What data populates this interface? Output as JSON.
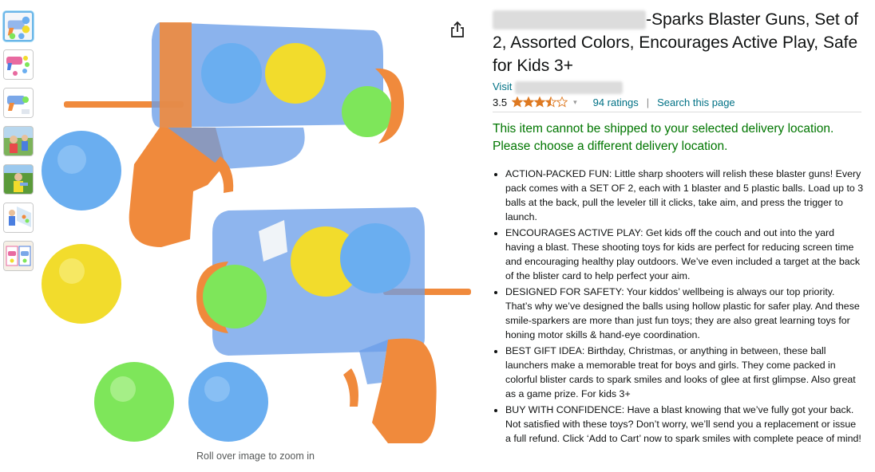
{
  "title": {
    "blurred_prefix": "redacted brand name",
    "text": "-Sparks Blaster Guns, Set of 2, Assorted Colors, Encourages Active Play, Safe for Kids 3+"
  },
  "visit": {
    "prefix": "Visit",
    "blurred": "redacted store"
  },
  "rating": {
    "value": "3.5",
    "stars": 3.5,
    "count_text": "94 ratings",
    "search_text": "Search this page",
    "separator": "|"
  },
  "shipping_warning": "This item cannot be shipped to your selected delivery location. Please choose a different delivery location.",
  "bullets": [
    "ACTION-PACKED FUN: Little sharp shooters will relish these blaster guns! Every pack comes with a SET OF 2, each with 1 blaster and 5 plastic balls. Load up to 3 balls at the back, pull the leveler till it clicks, take aim, and press the trigger to launch.",
    "ENCOURAGES ACTIVE PLAY: Get kids off the couch and out into the yard having a blast. These shooting toys for kids are perfect for reducing screen time and encouraging healthy play outdoors. We’ve even included a target at the back of the blister card to help perfect your aim.",
    "DESIGNED FOR SAFETY: Your kiddos’ wellbeing is always our top priority. That’s why we’ve designed the balls using hollow plastic for safer play. And these smile-sparkers are more than just fun toys; they are also great learning toys for honing motor skills & hand-eye coordination.",
    "BEST GIFT IDEA: Birthday, Christmas, or anything in between, these ball launchers make a memorable treat for boys and girls. They come packed in colorful blister cards to spark smiles and looks of glee at first glimpse. Also great as a game prize. For kids 3+",
    "BUY WITH CONFIDENCE: Have a blast knowing that we’ve fully got your back. Not satisfied with these toys? Don’t worry, we’ll send you a replacement or issue a full refund. Click ‘Add to Cart’ now to spark smiles with complete peace of mind!"
  ],
  "zoom_hint": "Roll over image to zoom in",
  "colors": {
    "link": "#007185",
    "warning": "#007600",
    "star": "#de7921",
    "blaster_orange": "#f08a3c",
    "blaster_blue": "#6a9ee8",
    "ball_blue": "#6aaef0",
    "ball_yellow": "#f2dc2c",
    "ball_green": "#7ee65a"
  },
  "icons": [
    "share-icon",
    "star-icon",
    "chevron-down-icon"
  ],
  "thumbnails": [
    {
      "label": "thumbnail-1",
      "selected": true
    },
    {
      "label": "thumbnail-2",
      "selected": false
    },
    {
      "label": "thumbnail-3",
      "selected": false
    },
    {
      "label": "thumbnail-4",
      "selected": false
    },
    {
      "label": "thumbnail-5",
      "selected": false
    },
    {
      "label": "thumbnail-6",
      "selected": false
    },
    {
      "label": "thumbnail-7",
      "selected": false
    }
  ]
}
